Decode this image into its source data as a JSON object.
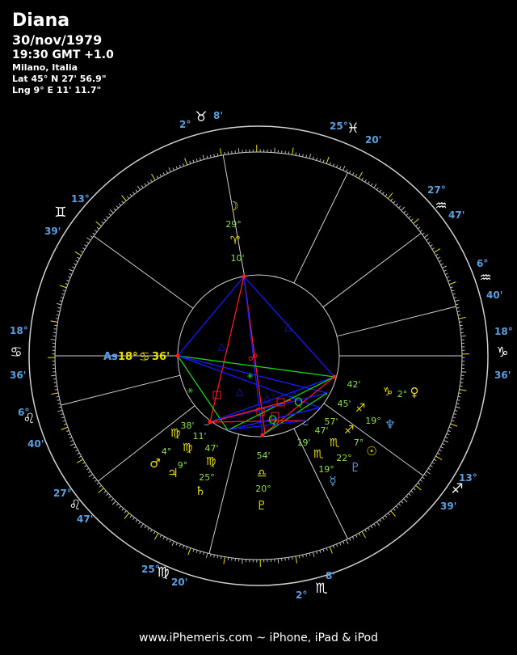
{
  "header": {
    "name": "Diana",
    "date": "30/nov/1979",
    "time": "19:30 GMT +1.0",
    "place": "Milano, Italia",
    "lat": "Lat 45° N 27' 56.9\"",
    "lng": "Lng 9° E 11' 11.7\""
  },
  "footer": "www.iPhemeris.com ~ iPhone, iPad & iPod",
  "colors": {
    "cusp": "#5aa0e0",
    "planet_deg": "#8de04a",
    "planet_min": "#8de04a",
    "aspect_red": "#ff1a1a",
    "aspect_blue": "#1a1aff",
    "aspect_green": "#1ad01a",
    "glyph_yellow": "#e8e000",
    "glyph_blue": "#5aa0e0"
  },
  "cusps": [
    {
      "sign": "♉",
      "deg": "2°",
      "min": "8'"
    },
    {
      "sign": "♓",
      "deg": "25°",
      "min": "20'"
    },
    {
      "sign": "♒",
      "deg": "27°",
      "min": "47'"
    },
    {
      "sign": "♒",
      "deg": "6°",
      "min": "40'"
    },
    {
      "sign": "♑",
      "deg": "18°",
      "min": "36'"
    },
    {
      "sign": "♐",
      "deg": "13°",
      "min": "39'"
    },
    {
      "sign": "♏",
      "deg": "2°",
      "min": "8'"
    },
    {
      "sign": "♍",
      "deg": "25°",
      "min": "20'"
    },
    {
      "sign": "♌",
      "deg": "27°",
      "min": "47'"
    },
    {
      "sign": "♌",
      "deg": "6°",
      "min": "40'"
    },
    {
      "sign": "♋",
      "deg": "18°",
      "min": "36'"
    },
    {
      "sign": "♊",
      "deg": "13°",
      "min": "39'"
    }
  ],
  "asc": {
    "glyph": "As",
    "deg": "18°",
    "sign": "♋",
    "min": "36'"
  },
  "planets": [
    {
      "glyph": "☽",
      "deg": "29°",
      "sign": "♈",
      "min": "10'"
    },
    {
      "glyph": "♀",
      "deg": "2°",
      "sign": "♑",
      "min": "42'"
    },
    {
      "glyph": "♆",
      "deg": "19°",
      "sign": "♐",
      "min": "45'"
    },
    {
      "glyph": "☉",
      "deg": "7°",
      "sign": "♐",
      "min": "57'"
    },
    {
      "glyph": "☿",
      "deg": "19°",
      "sign": "♏",
      "min": "19'"
    },
    {
      "glyph": "♇",
      "deg": "22°",
      "sign": "♏",
      "min": "47'"
    },
    {
      "glyph": "♇",
      "deg": "20°",
      "sign": "♎",
      "min": "54'"
    },
    {
      "glyph": "♄",
      "deg": "25°",
      "sign": "♍",
      "min": "47'"
    },
    {
      "glyph": "♃",
      "deg": "9°",
      "sign": "♍",
      "min": "11'"
    },
    {
      "glyph": "♂",
      "deg": "4°",
      "sign": "♍",
      "min": "38'"
    }
  ]
}
